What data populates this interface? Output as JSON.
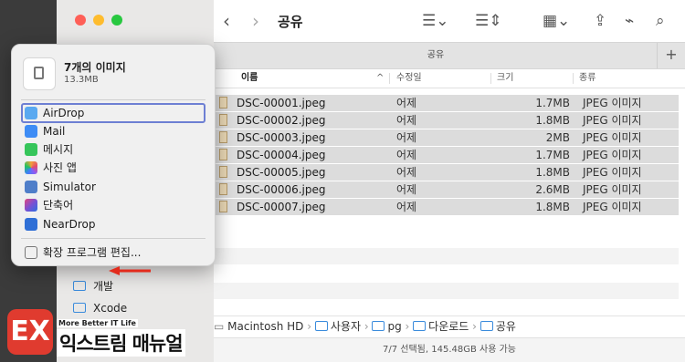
{
  "window": {
    "title": "공유",
    "tab_label": "공유",
    "tab_add": "+"
  },
  "toolbar": {
    "back_icon": "chevron-left-icon",
    "forward_icon": "chevron-right-icon",
    "list_view_icon": "list-icon",
    "group_icon": "group-icon",
    "gallery_icon": "grid-icon",
    "share_icon": "share-icon",
    "search_icon": "search-icon"
  },
  "columns": {
    "name": "이름",
    "modified": "수정일",
    "size": "크기",
    "kind": "종류"
  },
  "files": [
    {
      "name": "DSC-00001.jpeg",
      "date": "어제",
      "size": "1.7MB",
      "kind": "JPEG 이미지"
    },
    {
      "name": "DSC-00002.jpeg",
      "date": "어제",
      "size": "1.8MB",
      "kind": "JPEG 이미지"
    },
    {
      "name": "DSC-00003.jpeg",
      "date": "어제",
      "size": "2MB",
      "kind": "JPEG 이미지"
    },
    {
      "name": "DSC-00004.jpeg",
      "date": "어제",
      "size": "1.7MB",
      "kind": "JPEG 이미지"
    },
    {
      "name": "DSC-00005.jpeg",
      "date": "어제",
      "size": "1.8MB",
      "kind": "JPEG 이미지"
    },
    {
      "name": "DSC-00006.jpeg",
      "date": "어제",
      "size": "2.6MB",
      "kind": "JPEG 이미지"
    },
    {
      "name": "DSC-00007.jpeg",
      "date": "어제",
      "size": "1.8MB",
      "kind": "JPEG 이미지"
    }
  ],
  "path": {
    "p0": "Macintosh HD",
    "p1": "사용자",
    "p2": "pg",
    "p3": "다운로드",
    "p4": "공유"
  },
  "status": "7/7 선택됨, 145.48GB 사용 가능",
  "sidebar": {
    "item_dev": "개발",
    "item_xcode": "Xcode"
  },
  "share_popup": {
    "title": "7개의 이미지",
    "subtitle": "13.3MB",
    "items": [
      {
        "label": "AirDrop",
        "color": "#5aa9f0"
      },
      {
        "label": "Mail",
        "color": "#3e8cf5"
      },
      {
        "label": "메시지",
        "color": "#36c55a"
      },
      {
        "label": "사진 앱",
        "color": "#f2a03a"
      },
      {
        "label": "Simulator",
        "color": "#4f7ec9"
      },
      {
        "label": "단축어",
        "color": "#7a4fd3"
      },
      {
        "label": "NearDrop",
        "color": "#2f6fd6"
      }
    ],
    "edit": "확장 프로그램 편집..."
  },
  "logo": {
    "tagline": "More Better IT Life",
    "name": "익스트림 매뉴얼",
    "mark": "EX"
  },
  "colors": {
    "accent_arrow": "#e32b1c",
    "focus_ring": "#6d7fd3"
  }
}
